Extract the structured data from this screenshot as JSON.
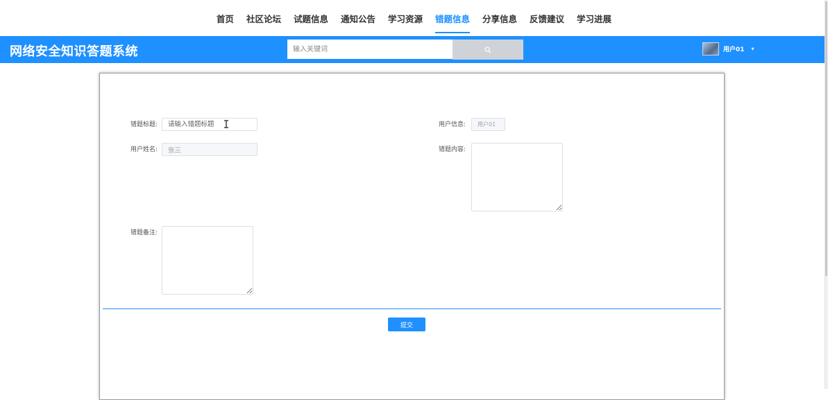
{
  "nav": {
    "items": [
      {
        "label": "首页",
        "active": false
      },
      {
        "label": "社区论坛",
        "active": false
      },
      {
        "label": "试题信息",
        "active": false
      },
      {
        "label": "通知公告",
        "active": false
      },
      {
        "label": "学习资源",
        "active": false
      },
      {
        "label": "错题信息",
        "active": true
      },
      {
        "label": "分享信息",
        "active": false
      },
      {
        "label": "反馈建议",
        "active": false
      },
      {
        "label": "学习进展",
        "active": false
      }
    ]
  },
  "header": {
    "title": "网络安全知识答题系统",
    "search_placeholder": "输入关键词",
    "user_name": "用户01",
    "caret": "▾"
  },
  "form": {
    "title_label": "错题标题:",
    "title_placeholder": "请输入错题标题",
    "userinfo_label": "用户信息:",
    "userinfo_value": "用户01",
    "username_label": "用户姓名:",
    "username_value": "张三",
    "content_label": "错题内容:",
    "remark_label": "错题备注:",
    "submit_label": "提交"
  },
  "colors": {
    "accent": "#1e90ff",
    "active_nav": "#1890ff"
  },
  "icons": {
    "search": "search-icon",
    "cursor": "text-cursor-icon",
    "dropdown": "chevron-down-icon"
  }
}
